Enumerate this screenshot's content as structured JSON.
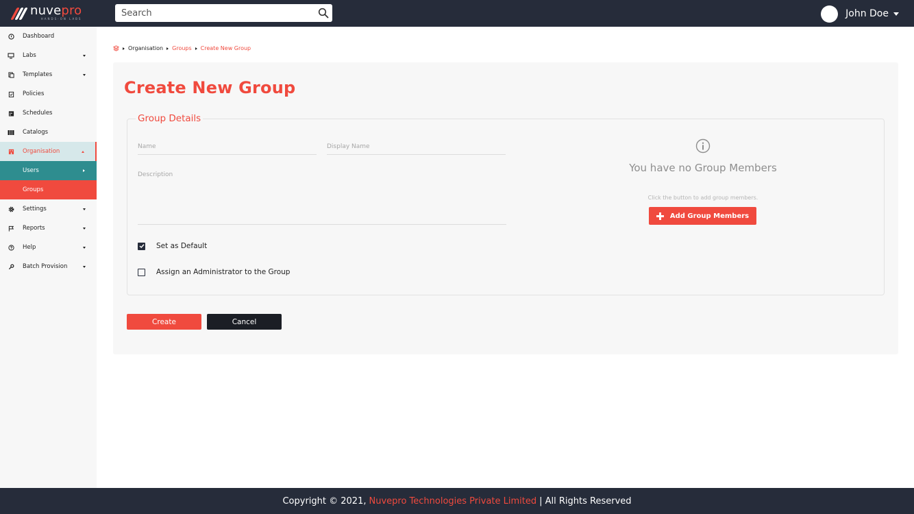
{
  "header": {
    "logo": {
      "name_white": "nuve",
      "name_red": "pro",
      "tagline": "HANDS-ON LABS"
    },
    "search": {
      "placeholder": "Search"
    },
    "user": {
      "name": "John Doe"
    }
  },
  "sidebar": {
    "items": [
      {
        "label": "Dashboard",
        "icon": "dashboard-icon"
      },
      {
        "label": "Labs",
        "icon": "monitor-icon"
      },
      {
        "label": "Templates",
        "icon": "copy-icon"
      },
      {
        "label": "Policies",
        "icon": "clipboard-icon"
      },
      {
        "label": "Schedules",
        "icon": "calendar-icon"
      },
      {
        "label": "Catalogs",
        "icon": "catalog-icon"
      },
      {
        "label": "Organisation",
        "icon": "organisation-icon"
      },
      {
        "label": "Settings",
        "icon": "gear-icon"
      },
      {
        "label": "Reports",
        "icon": "flag-icon"
      },
      {
        "label": "Help",
        "icon": "help-icon"
      },
      {
        "label": "Batch Provision",
        "icon": "key-icon"
      }
    ],
    "sub_items": [
      {
        "label": "Users"
      },
      {
        "label": "Groups"
      }
    ]
  },
  "breadcrumb": {
    "items": [
      "Organisation",
      "Groups",
      "Create New Group"
    ]
  },
  "form": {
    "title": "Create New Group",
    "section_title": "Group Details",
    "name_placeholder": "Name",
    "display_name_placeholder": "Display Name",
    "description_placeholder": "Description",
    "set_default_label": "Set as Default",
    "set_default_checked": true,
    "assign_admin_label": "Assign an Administrator to the Group",
    "assign_admin_checked": false,
    "create_label": "Create",
    "cancel_label": "Cancel"
  },
  "members": {
    "empty_title": "You have no Group Members",
    "hint": "Click the button to add group members.",
    "add_button_label": "Add Group Members"
  },
  "footer": {
    "prefix": "Copyright © 2021,",
    "company": "Nuvepro Technologies Private Limited",
    "suffix": "| All Rights Reserved"
  },
  "colors": {
    "accent": "#f04a3e",
    "topbar": "#262c3a",
    "teal": "#2e8d8f"
  }
}
